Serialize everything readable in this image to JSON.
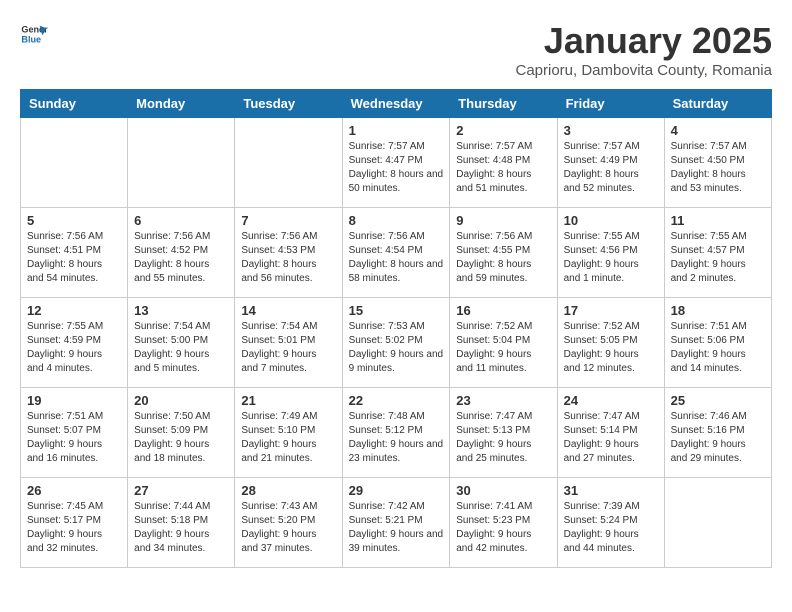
{
  "logo": {
    "text_general": "General",
    "text_blue": "Blue"
  },
  "title": "January 2025",
  "subtitle": "Caprioru, Dambovita County, Romania",
  "weekdays": [
    "Sunday",
    "Monday",
    "Tuesday",
    "Wednesday",
    "Thursday",
    "Friday",
    "Saturday"
  ],
  "weeks": [
    [
      {
        "day": "",
        "sunrise": "",
        "sunset": "",
        "daylight": ""
      },
      {
        "day": "",
        "sunrise": "",
        "sunset": "",
        "daylight": ""
      },
      {
        "day": "",
        "sunrise": "",
        "sunset": "",
        "daylight": ""
      },
      {
        "day": "1",
        "sunrise": "Sunrise: 7:57 AM",
        "sunset": "Sunset: 4:47 PM",
        "daylight": "Daylight: 8 hours and 50 minutes."
      },
      {
        "day": "2",
        "sunrise": "Sunrise: 7:57 AM",
        "sunset": "Sunset: 4:48 PM",
        "daylight": "Daylight: 8 hours and 51 minutes."
      },
      {
        "day": "3",
        "sunrise": "Sunrise: 7:57 AM",
        "sunset": "Sunset: 4:49 PM",
        "daylight": "Daylight: 8 hours and 52 minutes."
      },
      {
        "day": "4",
        "sunrise": "Sunrise: 7:57 AM",
        "sunset": "Sunset: 4:50 PM",
        "daylight": "Daylight: 8 hours and 53 minutes."
      }
    ],
    [
      {
        "day": "5",
        "sunrise": "Sunrise: 7:56 AM",
        "sunset": "Sunset: 4:51 PM",
        "daylight": "Daylight: 8 hours and 54 minutes."
      },
      {
        "day": "6",
        "sunrise": "Sunrise: 7:56 AM",
        "sunset": "Sunset: 4:52 PM",
        "daylight": "Daylight: 8 hours and 55 minutes."
      },
      {
        "day": "7",
        "sunrise": "Sunrise: 7:56 AM",
        "sunset": "Sunset: 4:53 PM",
        "daylight": "Daylight: 8 hours and 56 minutes."
      },
      {
        "day": "8",
        "sunrise": "Sunrise: 7:56 AM",
        "sunset": "Sunset: 4:54 PM",
        "daylight": "Daylight: 8 hours and 58 minutes."
      },
      {
        "day": "9",
        "sunrise": "Sunrise: 7:56 AM",
        "sunset": "Sunset: 4:55 PM",
        "daylight": "Daylight: 8 hours and 59 minutes."
      },
      {
        "day": "10",
        "sunrise": "Sunrise: 7:55 AM",
        "sunset": "Sunset: 4:56 PM",
        "daylight": "Daylight: 9 hours and 1 minute."
      },
      {
        "day": "11",
        "sunrise": "Sunrise: 7:55 AM",
        "sunset": "Sunset: 4:57 PM",
        "daylight": "Daylight: 9 hours and 2 minutes."
      }
    ],
    [
      {
        "day": "12",
        "sunrise": "Sunrise: 7:55 AM",
        "sunset": "Sunset: 4:59 PM",
        "daylight": "Daylight: 9 hours and 4 minutes."
      },
      {
        "day": "13",
        "sunrise": "Sunrise: 7:54 AM",
        "sunset": "Sunset: 5:00 PM",
        "daylight": "Daylight: 9 hours and 5 minutes."
      },
      {
        "day": "14",
        "sunrise": "Sunrise: 7:54 AM",
        "sunset": "Sunset: 5:01 PM",
        "daylight": "Daylight: 9 hours and 7 minutes."
      },
      {
        "day": "15",
        "sunrise": "Sunrise: 7:53 AM",
        "sunset": "Sunset: 5:02 PM",
        "daylight": "Daylight: 9 hours and 9 minutes."
      },
      {
        "day": "16",
        "sunrise": "Sunrise: 7:52 AM",
        "sunset": "Sunset: 5:04 PM",
        "daylight": "Daylight: 9 hours and 11 minutes."
      },
      {
        "day": "17",
        "sunrise": "Sunrise: 7:52 AM",
        "sunset": "Sunset: 5:05 PM",
        "daylight": "Daylight: 9 hours and 12 minutes."
      },
      {
        "day": "18",
        "sunrise": "Sunrise: 7:51 AM",
        "sunset": "Sunset: 5:06 PM",
        "daylight": "Daylight: 9 hours and 14 minutes."
      }
    ],
    [
      {
        "day": "19",
        "sunrise": "Sunrise: 7:51 AM",
        "sunset": "Sunset: 5:07 PM",
        "daylight": "Daylight: 9 hours and 16 minutes."
      },
      {
        "day": "20",
        "sunrise": "Sunrise: 7:50 AM",
        "sunset": "Sunset: 5:09 PM",
        "daylight": "Daylight: 9 hours and 18 minutes."
      },
      {
        "day": "21",
        "sunrise": "Sunrise: 7:49 AM",
        "sunset": "Sunset: 5:10 PM",
        "daylight": "Daylight: 9 hours and 21 minutes."
      },
      {
        "day": "22",
        "sunrise": "Sunrise: 7:48 AM",
        "sunset": "Sunset: 5:12 PM",
        "daylight": "Daylight: 9 hours and 23 minutes."
      },
      {
        "day": "23",
        "sunrise": "Sunrise: 7:47 AM",
        "sunset": "Sunset: 5:13 PM",
        "daylight": "Daylight: 9 hours and 25 minutes."
      },
      {
        "day": "24",
        "sunrise": "Sunrise: 7:47 AM",
        "sunset": "Sunset: 5:14 PM",
        "daylight": "Daylight: 9 hours and 27 minutes."
      },
      {
        "day": "25",
        "sunrise": "Sunrise: 7:46 AM",
        "sunset": "Sunset: 5:16 PM",
        "daylight": "Daylight: 9 hours and 29 minutes."
      }
    ],
    [
      {
        "day": "26",
        "sunrise": "Sunrise: 7:45 AM",
        "sunset": "Sunset: 5:17 PM",
        "daylight": "Daylight: 9 hours and 32 minutes."
      },
      {
        "day": "27",
        "sunrise": "Sunrise: 7:44 AM",
        "sunset": "Sunset: 5:18 PM",
        "daylight": "Daylight: 9 hours and 34 minutes."
      },
      {
        "day": "28",
        "sunrise": "Sunrise: 7:43 AM",
        "sunset": "Sunset: 5:20 PM",
        "daylight": "Daylight: 9 hours and 37 minutes."
      },
      {
        "day": "29",
        "sunrise": "Sunrise: 7:42 AM",
        "sunset": "Sunset: 5:21 PM",
        "daylight": "Daylight: 9 hours and 39 minutes."
      },
      {
        "day": "30",
        "sunrise": "Sunrise: 7:41 AM",
        "sunset": "Sunset: 5:23 PM",
        "daylight": "Daylight: 9 hours and 42 minutes."
      },
      {
        "day": "31",
        "sunrise": "Sunrise: 7:39 AM",
        "sunset": "Sunset: 5:24 PM",
        "daylight": "Daylight: 9 hours and 44 minutes."
      },
      {
        "day": "",
        "sunrise": "",
        "sunset": "",
        "daylight": ""
      }
    ]
  ]
}
